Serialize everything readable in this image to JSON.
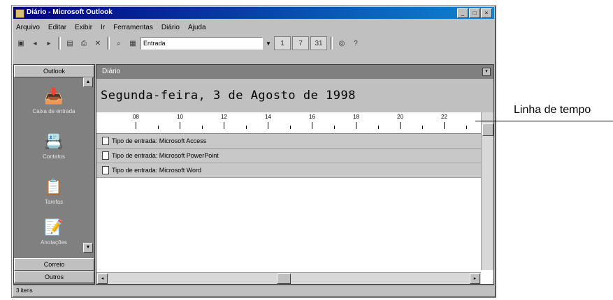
{
  "window": {
    "title": "Diário - Microsoft Outlook",
    "controls": [
      "_",
      "□",
      "×"
    ]
  },
  "menu": [
    "Arquivo",
    "Editar",
    "Exibir",
    "Ir",
    "Ferramentas",
    "Diário",
    "Ajuda"
  ],
  "toolbar": {
    "combo_value": "Entrada",
    "icons": [
      "new-icon",
      "back-icon",
      "forward-icon",
      "folder-list-icon",
      "print-icon",
      "delete-icon",
      "find-icon",
      "day-view-icon",
      "week-view-icon",
      "month-view-icon",
      "help-icon"
    ]
  },
  "outlook_bar": {
    "top_group": "Outlook",
    "shortcuts": [
      "Caixa de entrada",
      "Contatos",
      "Tarefas",
      "Anotações"
    ],
    "bottom_groups": [
      "Correio",
      "Outros"
    ]
  },
  "main": {
    "header": "Diário",
    "date": "Segunda-feira, 3 de Agosto de 1998",
    "timeline_ticks": [
      "08",
      "10",
      "12",
      "14",
      "16",
      "18",
      "20",
      "22"
    ],
    "items": [
      "Tipo de entrada: Microsoft Access",
      "Tipo de entrada: Microsoft PowerPoint",
      "Tipo de entrada: Microsoft Word"
    ]
  },
  "statusbar": "3 itens",
  "callout": {
    "label": "Linha de tempo"
  }
}
